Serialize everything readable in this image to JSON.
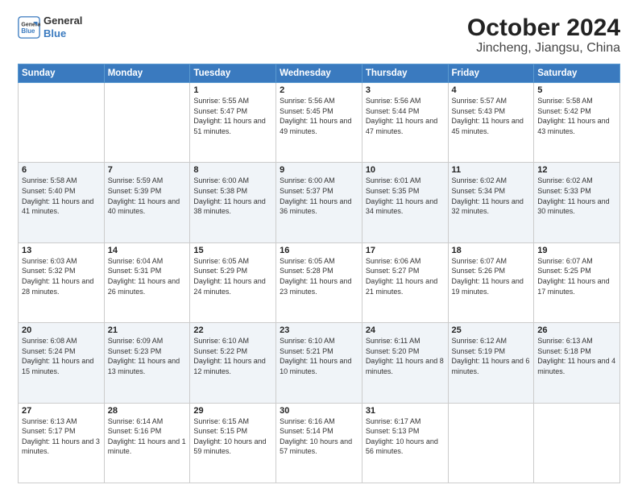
{
  "logo": {
    "line1": "General",
    "line2": "Blue"
  },
  "title": "October 2024",
  "subtitle": "Jincheng, Jiangsu, China",
  "days_header": [
    "Sunday",
    "Monday",
    "Tuesday",
    "Wednesday",
    "Thursday",
    "Friday",
    "Saturday"
  ],
  "weeks": [
    [
      {
        "num": "",
        "info": ""
      },
      {
        "num": "",
        "info": ""
      },
      {
        "num": "1",
        "info": "Sunrise: 5:55 AM\nSunset: 5:47 PM\nDaylight: 11 hours and 51 minutes."
      },
      {
        "num": "2",
        "info": "Sunrise: 5:56 AM\nSunset: 5:45 PM\nDaylight: 11 hours and 49 minutes."
      },
      {
        "num": "3",
        "info": "Sunrise: 5:56 AM\nSunset: 5:44 PM\nDaylight: 11 hours and 47 minutes."
      },
      {
        "num": "4",
        "info": "Sunrise: 5:57 AM\nSunset: 5:43 PM\nDaylight: 11 hours and 45 minutes."
      },
      {
        "num": "5",
        "info": "Sunrise: 5:58 AM\nSunset: 5:42 PM\nDaylight: 11 hours and 43 minutes."
      }
    ],
    [
      {
        "num": "6",
        "info": "Sunrise: 5:58 AM\nSunset: 5:40 PM\nDaylight: 11 hours and 41 minutes."
      },
      {
        "num": "7",
        "info": "Sunrise: 5:59 AM\nSunset: 5:39 PM\nDaylight: 11 hours and 40 minutes."
      },
      {
        "num": "8",
        "info": "Sunrise: 6:00 AM\nSunset: 5:38 PM\nDaylight: 11 hours and 38 minutes."
      },
      {
        "num": "9",
        "info": "Sunrise: 6:00 AM\nSunset: 5:37 PM\nDaylight: 11 hours and 36 minutes."
      },
      {
        "num": "10",
        "info": "Sunrise: 6:01 AM\nSunset: 5:35 PM\nDaylight: 11 hours and 34 minutes."
      },
      {
        "num": "11",
        "info": "Sunrise: 6:02 AM\nSunset: 5:34 PM\nDaylight: 11 hours and 32 minutes."
      },
      {
        "num": "12",
        "info": "Sunrise: 6:02 AM\nSunset: 5:33 PM\nDaylight: 11 hours and 30 minutes."
      }
    ],
    [
      {
        "num": "13",
        "info": "Sunrise: 6:03 AM\nSunset: 5:32 PM\nDaylight: 11 hours and 28 minutes."
      },
      {
        "num": "14",
        "info": "Sunrise: 6:04 AM\nSunset: 5:31 PM\nDaylight: 11 hours and 26 minutes."
      },
      {
        "num": "15",
        "info": "Sunrise: 6:05 AM\nSunset: 5:29 PM\nDaylight: 11 hours and 24 minutes."
      },
      {
        "num": "16",
        "info": "Sunrise: 6:05 AM\nSunset: 5:28 PM\nDaylight: 11 hours and 23 minutes."
      },
      {
        "num": "17",
        "info": "Sunrise: 6:06 AM\nSunset: 5:27 PM\nDaylight: 11 hours and 21 minutes."
      },
      {
        "num": "18",
        "info": "Sunrise: 6:07 AM\nSunset: 5:26 PM\nDaylight: 11 hours and 19 minutes."
      },
      {
        "num": "19",
        "info": "Sunrise: 6:07 AM\nSunset: 5:25 PM\nDaylight: 11 hours and 17 minutes."
      }
    ],
    [
      {
        "num": "20",
        "info": "Sunrise: 6:08 AM\nSunset: 5:24 PM\nDaylight: 11 hours and 15 minutes."
      },
      {
        "num": "21",
        "info": "Sunrise: 6:09 AM\nSunset: 5:23 PM\nDaylight: 11 hours and 13 minutes."
      },
      {
        "num": "22",
        "info": "Sunrise: 6:10 AM\nSunset: 5:22 PM\nDaylight: 11 hours and 12 minutes."
      },
      {
        "num": "23",
        "info": "Sunrise: 6:10 AM\nSunset: 5:21 PM\nDaylight: 11 hours and 10 minutes."
      },
      {
        "num": "24",
        "info": "Sunrise: 6:11 AM\nSunset: 5:20 PM\nDaylight: 11 hours and 8 minutes."
      },
      {
        "num": "25",
        "info": "Sunrise: 6:12 AM\nSunset: 5:19 PM\nDaylight: 11 hours and 6 minutes."
      },
      {
        "num": "26",
        "info": "Sunrise: 6:13 AM\nSunset: 5:18 PM\nDaylight: 11 hours and 4 minutes."
      }
    ],
    [
      {
        "num": "27",
        "info": "Sunrise: 6:13 AM\nSunset: 5:17 PM\nDaylight: 11 hours and 3 minutes."
      },
      {
        "num": "28",
        "info": "Sunrise: 6:14 AM\nSunset: 5:16 PM\nDaylight: 11 hours and 1 minute."
      },
      {
        "num": "29",
        "info": "Sunrise: 6:15 AM\nSunset: 5:15 PM\nDaylight: 10 hours and 59 minutes."
      },
      {
        "num": "30",
        "info": "Sunrise: 6:16 AM\nSunset: 5:14 PM\nDaylight: 10 hours and 57 minutes."
      },
      {
        "num": "31",
        "info": "Sunrise: 6:17 AM\nSunset: 5:13 PM\nDaylight: 10 hours and 56 minutes."
      },
      {
        "num": "",
        "info": ""
      },
      {
        "num": "",
        "info": ""
      }
    ]
  ]
}
